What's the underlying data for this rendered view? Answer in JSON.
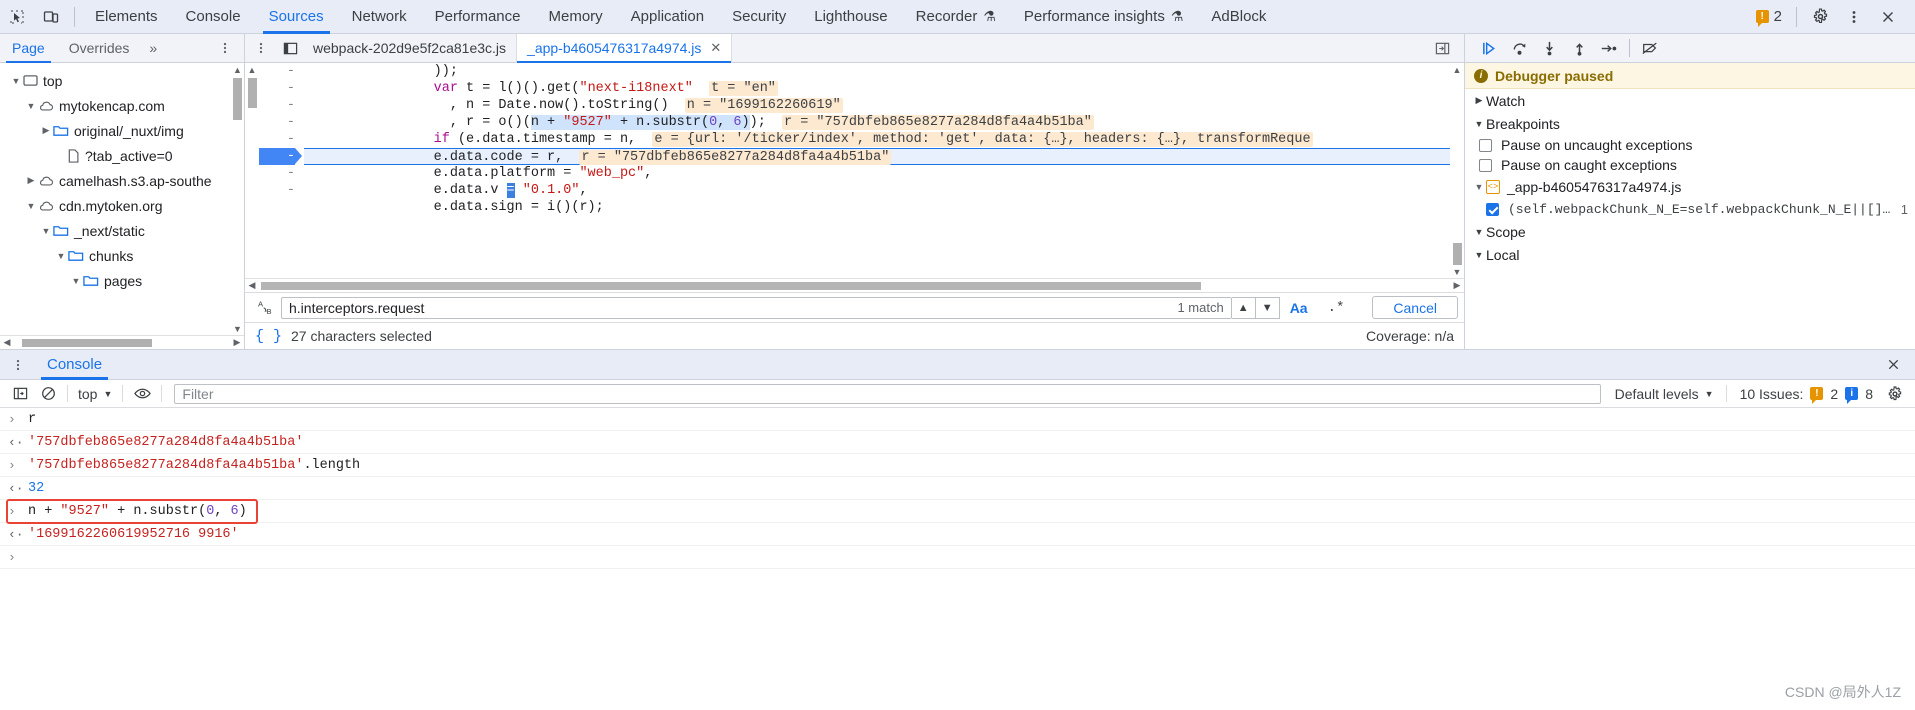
{
  "topbar": {
    "inspect_icon": "inspect-cursor-icon",
    "device_icon": "device-toolbar-icon",
    "tabs": [
      {
        "label": "Elements",
        "selected": false,
        "flask": false
      },
      {
        "label": "Console",
        "selected": false,
        "flask": false
      },
      {
        "label": "Sources",
        "selected": true,
        "flask": false
      },
      {
        "label": "Network",
        "selected": false,
        "flask": false
      },
      {
        "label": "Performance",
        "selected": false,
        "flask": false
      },
      {
        "label": "Memory",
        "selected": false,
        "flask": false
      },
      {
        "label": "Application",
        "selected": false,
        "flask": false
      },
      {
        "label": "Security",
        "selected": false,
        "flask": false
      },
      {
        "label": "Lighthouse",
        "selected": false,
        "flask": false
      },
      {
        "label": "Recorder",
        "selected": false,
        "flask": true
      },
      {
        "label": "Performance insights",
        "selected": false,
        "flask": true
      },
      {
        "label": "AdBlock",
        "selected": false,
        "flask": false
      }
    ],
    "warning_count": "2",
    "settings_icon": "gear-icon",
    "more_icon": "more-vertical-icon",
    "close_icon": "close-icon"
  },
  "navigator": {
    "tabs": [
      {
        "label": "Page",
        "selected": true
      },
      {
        "label": "Overrides",
        "selected": false
      }
    ],
    "more_tabs_label": "»",
    "menu_icon": "more-vertical-icon",
    "tree": [
      {
        "label": "top",
        "indent": 0,
        "arrow": "down",
        "icon": "frame-icon"
      },
      {
        "label": "mytokencap.com",
        "indent": 1,
        "arrow": "down",
        "icon": "cloud-icon"
      },
      {
        "label": "original/_nuxt/img",
        "indent": 2,
        "arrow": "right",
        "icon": "folder-icon"
      },
      {
        "label": "?tab_active=0",
        "indent": 2,
        "arrow": "none",
        "icon": "file-icon"
      },
      {
        "label": "camelhash.s3.ap-southe",
        "indent": 1,
        "arrow": "right",
        "icon": "cloud-icon"
      },
      {
        "label": "cdn.mytoken.org",
        "indent": 1,
        "arrow": "down",
        "icon": "cloud-icon"
      },
      {
        "label": "_next/static",
        "indent": 2,
        "arrow": "down",
        "icon": "folder-icon"
      },
      {
        "label": "chunks",
        "indent": 3,
        "arrow": "down",
        "icon": "folder-icon"
      },
      {
        "label": "pages",
        "indent": 4,
        "arrow": "down",
        "icon": "folder-icon"
      }
    ]
  },
  "editor": {
    "panel_toggle_icon": "show-navigator-icon",
    "more_icon": "more-vertical-icon",
    "tabs": [
      {
        "label": "webpack-202d9e5f2ca81e3c.js",
        "selected": false,
        "closable": false
      },
      {
        "label": "_app-b4605476317a4974.js",
        "selected": true,
        "closable": true
      }
    ],
    "right_icon": "show-debugger-icon",
    "code_lines": [
      {
        "num": "-",
        "current": false,
        "segments": [
          {
            "t": "                ));",
            "cls": "plain"
          }
        ]
      },
      {
        "num": "-",
        "current": false,
        "segments": [
          {
            "t": "                ",
            "cls": "plain"
          },
          {
            "t": "var",
            "cls": "kw2"
          },
          {
            "t": " t = l()().get(",
            "cls": "plain"
          },
          {
            "t": "\"next-i18next\"",
            "cls": "str"
          },
          {
            "t": "  ",
            "cls": "plain"
          },
          {
            "t": "t = \"en\"",
            "cls": "inline-val"
          }
        ]
      },
      {
        "num": "-",
        "current": false,
        "segments": [
          {
            "t": "                  , n = Date.now().toString()  ",
            "cls": "plain"
          },
          {
            "t": "n = \"1699162260619\"",
            "cls": "inline-val"
          }
        ]
      },
      {
        "num": "-",
        "current": false,
        "segments": [
          {
            "t": "                  , r = o()(",
            "cls": "plain"
          },
          {
            "t": "n + ",
            "cls": "selhl"
          },
          {
            "t": "\"9527\"",
            "cls": "selhl-str"
          },
          {
            "t": " + n.substr(",
            "cls": "selhl"
          },
          {
            "t": "0",
            "cls": "selhl-num"
          },
          {
            "t": ", ",
            "cls": "selhl"
          },
          {
            "t": "6",
            "cls": "selhl-num"
          },
          {
            "t": ")",
            "cls": "selhl"
          },
          {
            "t": ");  ",
            "cls": "plain"
          },
          {
            "t": "r = \"757dbfeb865e8277a284d8fa4a4b51ba\"",
            "cls": "inline-val"
          }
        ]
      },
      {
        "num": "-",
        "current": false,
        "segments": [
          {
            "t": "                ",
            "cls": "plain"
          },
          {
            "t": "if",
            "cls": "kw2"
          },
          {
            "t": " (e.data.timestamp = n,  ",
            "cls": "plain"
          },
          {
            "t": "e = {url: '/ticker/index', method: 'get', data: {…}, headers: {…}, transformReque",
            "cls": "inline-val"
          }
        ]
      },
      {
        "num": "-",
        "current": true,
        "segments": [
          {
            "t": "                e.data.code = r,  ",
            "cls": "plain"
          },
          {
            "t": "r = \"757dbfeb865e8277a284d8fa4a4b51ba\"",
            "cls": "inline-val"
          }
        ]
      },
      {
        "num": "-",
        "current": false,
        "segments": [
          {
            "t": "                e.data.platform = ",
            "cls": "plain"
          },
          {
            "t": "\"web_pc\"",
            "cls": "str"
          },
          {
            "t": ",",
            "cls": "plain"
          }
        ]
      },
      {
        "num": "-",
        "current": false,
        "segments": [
          {
            "t": "                e.data.v ",
            "cls": "plain"
          },
          {
            "t": "=",
            "cls": "cursor"
          },
          {
            "t": " ",
            "cls": "plain"
          },
          {
            "t": "\"0.1.0\"",
            "cls": "str"
          },
          {
            "t": ",",
            "cls": "plain"
          }
        ]
      }
    ]
  },
  "search": {
    "case_icon": "match-case-ab-icon",
    "query": "h.interceptors.request",
    "placeholder": "Find",
    "match_count": "1 match",
    "prev_icon": "chevron-up-icon",
    "next_icon": "chevron-down-icon",
    "match_case_label": "Aa",
    "regex_label": ".*",
    "cancel_label": "Cancel"
  },
  "status": {
    "format_icon": "pretty-print-braces-icon",
    "selection_text": "27 characters selected",
    "coverage_text": "Coverage: n/a"
  },
  "debugger": {
    "toolbar": [
      {
        "name": "resume-button",
        "icon": "resume-icon"
      },
      {
        "name": "step-over-button",
        "icon": "step-over-icon"
      },
      {
        "name": "step-into-button",
        "icon": "step-into-icon"
      },
      {
        "name": "step-out-button",
        "icon": "step-out-icon"
      },
      {
        "name": "step-button",
        "icon": "step-icon"
      },
      {
        "name": "deactivate-breakpoints-button",
        "icon": "deactivate-breakpoints-icon"
      }
    ],
    "paused_text": "Debugger paused",
    "sections": [
      {
        "label": "Watch",
        "expanded": false
      },
      {
        "label": "Breakpoints",
        "expanded": true
      },
      {
        "label": "Scope",
        "expanded": true
      },
      {
        "label": "Local",
        "expanded": true
      }
    ],
    "pause_uncaught_label": "Pause on uncaught exceptions",
    "pause_uncaught_checked": false,
    "pause_caught_label": "Pause on caught exceptions",
    "pause_caught_checked": false,
    "breakpoint_file": "_app-b4605476317a4974.js",
    "breakpoint_code": "(self.webpackChunk_N_E=self.webpackChunk_N_E||[]).pus…",
    "breakpoint_line": "1",
    "breakpoint_checked": true
  },
  "drawer": {
    "menu_icon": "more-vertical-icon",
    "tab_label": "Console",
    "close_icon": "close-icon",
    "toolbar": {
      "sidebar_icon": "console-sidebar-icon",
      "clear_icon": "clear-console-icon",
      "context_label": "top",
      "eye_icon": "live-expression-eye-icon",
      "filter_placeholder": "Filter",
      "levels_label": "Default levels",
      "issues_label": "10 Issues:",
      "issues_warnings": "2",
      "issues_info": "8",
      "settings_icon": "gear-icon"
    },
    "entries": [
      {
        "kind": "input",
        "segments": [
          {
            "t": "r",
            "cls": "plain"
          }
        ]
      },
      {
        "kind": "output",
        "segments": [
          {
            "t": "'757dbfeb865e8277a284d8fa4a4b51ba'",
            "cls": "cstr"
          }
        ]
      },
      {
        "kind": "input",
        "segments": [
          {
            "t": "'757dbfeb865e8277a284d8fa4a4b51ba'",
            "cls": "cstr"
          },
          {
            "t": ".length",
            "cls": "plain"
          }
        ]
      },
      {
        "kind": "output",
        "segments": [
          {
            "t": "32",
            "cls": "cnum"
          }
        ]
      },
      {
        "kind": "input",
        "highlighted": true,
        "segments": [
          {
            "t": "n + ",
            "cls": "plain"
          },
          {
            "t": "\"9527\"",
            "cls": "cstr"
          },
          {
            "t": " + n.substr(",
            "cls": "plain"
          },
          {
            "t": "0",
            "cls": "cnum-lit"
          },
          {
            "t": ", ",
            "cls": "plain"
          },
          {
            "t": "6",
            "cls": "cnum-lit"
          },
          {
            "t": ")",
            "cls": "plain"
          }
        ]
      },
      {
        "kind": "output",
        "segments": [
          {
            "t": "'1699162260619952716 9916'",
            "cls": "cstr"
          }
        ]
      },
      {
        "kind": "prompt",
        "segments": [
          {
            "t": "",
            "cls": "plain"
          }
        ]
      }
    ]
  },
  "watermark": "CSDN @局外人1Z",
  "colors": {
    "accent": "#1a73e8",
    "toolbar_bg": "#e8ecf7",
    "paused_bg": "#fdf6e3",
    "inline_value_bg": "#fde8d0",
    "selection_bg": "#cfe4fc",
    "error_red": "#c5221f",
    "highlight_box": "#ea4335"
  }
}
